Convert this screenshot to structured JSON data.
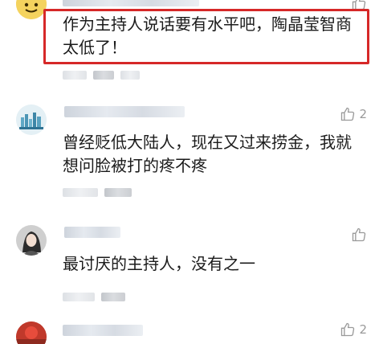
{
  "comments": [
    {
      "text": "作为主持人说话要有水平吧，陶晶莹智商太低了！",
      "likes": "",
      "highlighted": true
    },
    {
      "text": "曾经贬低大陆人，现在又过来捞金，我就想问脸被打的疼不疼",
      "likes": "2"
    },
    {
      "text": "最讨厌的主持人，没有之一",
      "likes": ""
    },
    {
      "text": "",
      "likes": "2"
    }
  ],
  "colors": {
    "highlight": "#d62828",
    "like_icon": "#9a9a9a"
  },
  "icons": {
    "like": "thumbs-up-icon"
  }
}
